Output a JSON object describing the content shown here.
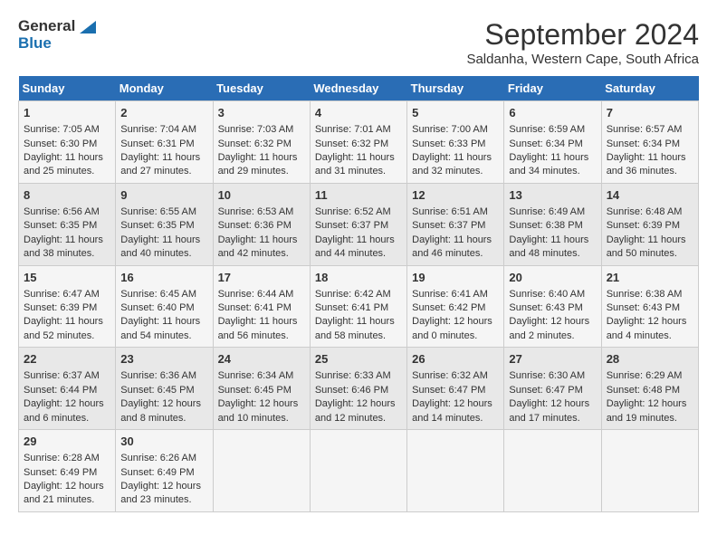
{
  "logo": {
    "line1": "General",
    "line2": "Blue"
  },
  "title": "September 2024",
  "subtitle": "Saldanha, Western Cape, South Africa",
  "days_of_week": [
    "Sunday",
    "Monday",
    "Tuesday",
    "Wednesday",
    "Thursday",
    "Friday",
    "Saturday"
  ],
  "weeks": [
    [
      {
        "day": "1",
        "sunrise": "Sunrise: 7:05 AM",
        "sunset": "Sunset: 6:30 PM",
        "daylight": "Daylight: 11 hours and 25 minutes."
      },
      {
        "day": "2",
        "sunrise": "Sunrise: 7:04 AM",
        "sunset": "Sunset: 6:31 PM",
        "daylight": "Daylight: 11 hours and 27 minutes."
      },
      {
        "day": "3",
        "sunrise": "Sunrise: 7:03 AM",
        "sunset": "Sunset: 6:32 PM",
        "daylight": "Daylight: 11 hours and 29 minutes."
      },
      {
        "day": "4",
        "sunrise": "Sunrise: 7:01 AM",
        "sunset": "Sunset: 6:32 PM",
        "daylight": "Daylight: 11 hours and 31 minutes."
      },
      {
        "day": "5",
        "sunrise": "Sunrise: 7:00 AM",
        "sunset": "Sunset: 6:33 PM",
        "daylight": "Daylight: 11 hours and 32 minutes."
      },
      {
        "day": "6",
        "sunrise": "Sunrise: 6:59 AM",
        "sunset": "Sunset: 6:34 PM",
        "daylight": "Daylight: 11 hours and 34 minutes."
      },
      {
        "day": "7",
        "sunrise": "Sunrise: 6:57 AM",
        "sunset": "Sunset: 6:34 PM",
        "daylight": "Daylight: 11 hours and 36 minutes."
      }
    ],
    [
      {
        "day": "8",
        "sunrise": "Sunrise: 6:56 AM",
        "sunset": "Sunset: 6:35 PM",
        "daylight": "Daylight: 11 hours and 38 minutes."
      },
      {
        "day": "9",
        "sunrise": "Sunrise: 6:55 AM",
        "sunset": "Sunset: 6:35 PM",
        "daylight": "Daylight: 11 hours and 40 minutes."
      },
      {
        "day": "10",
        "sunrise": "Sunrise: 6:53 AM",
        "sunset": "Sunset: 6:36 PM",
        "daylight": "Daylight: 11 hours and 42 minutes."
      },
      {
        "day": "11",
        "sunrise": "Sunrise: 6:52 AM",
        "sunset": "Sunset: 6:37 PM",
        "daylight": "Daylight: 11 hours and 44 minutes."
      },
      {
        "day": "12",
        "sunrise": "Sunrise: 6:51 AM",
        "sunset": "Sunset: 6:37 PM",
        "daylight": "Daylight: 11 hours and 46 minutes."
      },
      {
        "day": "13",
        "sunrise": "Sunrise: 6:49 AM",
        "sunset": "Sunset: 6:38 PM",
        "daylight": "Daylight: 11 hours and 48 minutes."
      },
      {
        "day": "14",
        "sunrise": "Sunrise: 6:48 AM",
        "sunset": "Sunset: 6:39 PM",
        "daylight": "Daylight: 11 hours and 50 minutes."
      }
    ],
    [
      {
        "day": "15",
        "sunrise": "Sunrise: 6:47 AM",
        "sunset": "Sunset: 6:39 PM",
        "daylight": "Daylight: 11 hours and 52 minutes."
      },
      {
        "day": "16",
        "sunrise": "Sunrise: 6:45 AM",
        "sunset": "Sunset: 6:40 PM",
        "daylight": "Daylight: 11 hours and 54 minutes."
      },
      {
        "day": "17",
        "sunrise": "Sunrise: 6:44 AM",
        "sunset": "Sunset: 6:41 PM",
        "daylight": "Daylight: 11 hours and 56 minutes."
      },
      {
        "day": "18",
        "sunrise": "Sunrise: 6:42 AM",
        "sunset": "Sunset: 6:41 PM",
        "daylight": "Daylight: 11 hours and 58 minutes."
      },
      {
        "day": "19",
        "sunrise": "Sunrise: 6:41 AM",
        "sunset": "Sunset: 6:42 PM",
        "daylight": "Daylight: 12 hours and 0 minutes."
      },
      {
        "day": "20",
        "sunrise": "Sunrise: 6:40 AM",
        "sunset": "Sunset: 6:43 PM",
        "daylight": "Daylight: 12 hours and 2 minutes."
      },
      {
        "day": "21",
        "sunrise": "Sunrise: 6:38 AM",
        "sunset": "Sunset: 6:43 PM",
        "daylight": "Daylight: 12 hours and 4 minutes."
      }
    ],
    [
      {
        "day": "22",
        "sunrise": "Sunrise: 6:37 AM",
        "sunset": "Sunset: 6:44 PM",
        "daylight": "Daylight: 12 hours and 6 minutes."
      },
      {
        "day": "23",
        "sunrise": "Sunrise: 6:36 AM",
        "sunset": "Sunset: 6:45 PM",
        "daylight": "Daylight: 12 hours and 8 minutes."
      },
      {
        "day": "24",
        "sunrise": "Sunrise: 6:34 AM",
        "sunset": "Sunset: 6:45 PM",
        "daylight": "Daylight: 12 hours and 10 minutes."
      },
      {
        "day": "25",
        "sunrise": "Sunrise: 6:33 AM",
        "sunset": "Sunset: 6:46 PM",
        "daylight": "Daylight: 12 hours and 12 minutes."
      },
      {
        "day": "26",
        "sunrise": "Sunrise: 6:32 AM",
        "sunset": "Sunset: 6:47 PM",
        "daylight": "Daylight: 12 hours and 14 minutes."
      },
      {
        "day": "27",
        "sunrise": "Sunrise: 6:30 AM",
        "sunset": "Sunset: 6:47 PM",
        "daylight": "Daylight: 12 hours and 17 minutes."
      },
      {
        "day": "28",
        "sunrise": "Sunrise: 6:29 AM",
        "sunset": "Sunset: 6:48 PM",
        "daylight": "Daylight: 12 hours and 19 minutes."
      }
    ],
    [
      {
        "day": "29",
        "sunrise": "Sunrise: 6:28 AM",
        "sunset": "Sunset: 6:49 PM",
        "daylight": "Daylight: 12 hours and 21 minutes."
      },
      {
        "day": "30",
        "sunrise": "Sunrise: 6:26 AM",
        "sunset": "Sunset: 6:49 PM",
        "daylight": "Daylight: 12 hours and 23 minutes."
      },
      null,
      null,
      null,
      null,
      null
    ]
  ]
}
